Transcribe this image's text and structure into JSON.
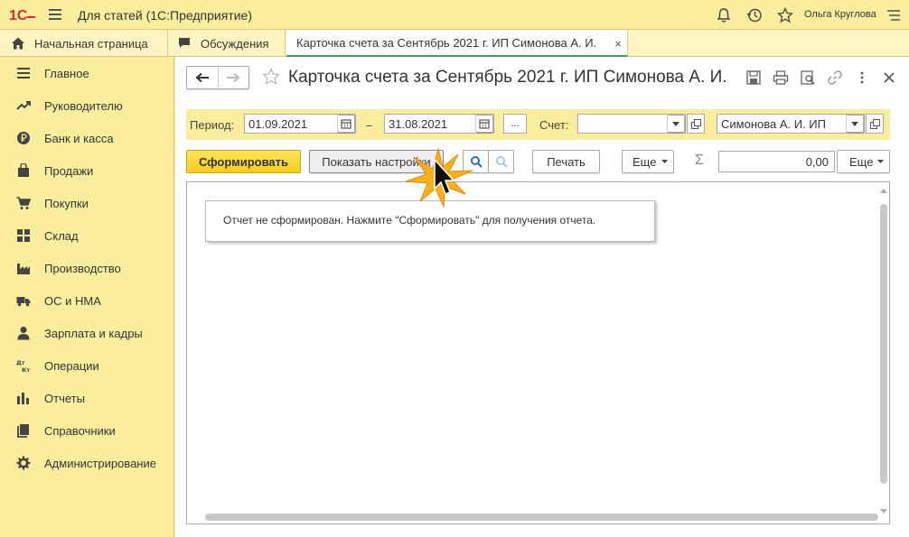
{
  "app": {
    "title": "Для статей  (1С:Предприятие)",
    "user": "Ольга Круглова"
  },
  "tabs": [
    {
      "label": "Начальная страница"
    },
    {
      "label": "Обсуждения"
    },
    {
      "label": "Карточка счета за Сентябрь 2021 г. ИП Симонова А. И."
    }
  ],
  "tab_close": "×",
  "sidebar": {
    "items": [
      {
        "label": "Главное"
      },
      {
        "label": "Руководителю"
      },
      {
        "label": "Банк и касса"
      },
      {
        "label": "Продажи"
      },
      {
        "label": "Покупки"
      },
      {
        "label": "Склад"
      },
      {
        "label": "Производство"
      },
      {
        "label": "ОС и НМА"
      },
      {
        "label": "Зарплата и кадры"
      },
      {
        "label": "Операции"
      },
      {
        "label": "Отчеты"
      },
      {
        "label": "Справочники"
      },
      {
        "label": "Администрирование"
      }
    ]
  },
  "form": {
    "title": "Карточка счета за Сентябрь 2021 г. ИП Симонова А. И.",
    "period_label": "Период:",
    "date_from": "01.09.2021",
    "dash": "–",
    "date_to": "31.08.2021",
    "period_select": "...",
    "account_label": "Счет:",
    "account_value": "",
    "organization_value": "Симонова А. И. ИП"
  },
  "commands": {
    "generate": "Сформировать",
    "show_settings": "Показать настройки",
    "print": "Печать",
    "more1": "Еще",
    "sum_value": "0,00",
    "more2": "Еще"
  },
  "report": {
    "message": "Отчет не сформирован. Нажмите \"Сформировать\" для получения отчета."
  }
}
